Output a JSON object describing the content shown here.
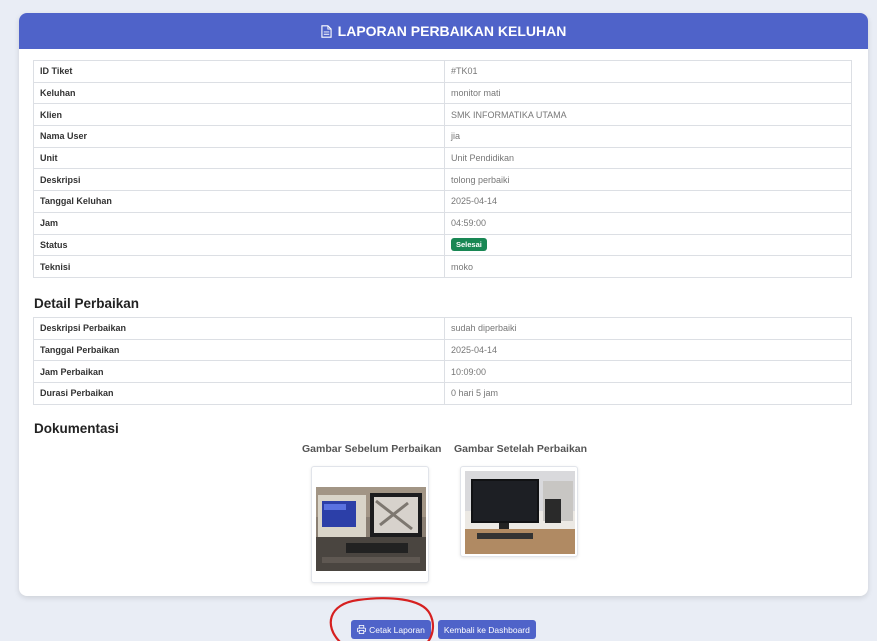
{
  "header": {
    "title": "LAPORAN PERBAIKAN KELUHAN",
    "icon": "document-icon"
  },
  "info_rows": [
    {
      "label": "ID Tiket",
      "value": "#TK01"
    },
    {
      "label": "Keluhan",
      "value": "monitor mati"
    },
    {
      "label": "Klien",
      "value": "SMK INFORMATIKA UTAMA"
    },
    {
      "label": "Nama User",
      "value": "jia"
    },
    {
      "label": "Unit",
      "value": "Unit Pendidikan"
    },
    {
      "label": "Deskripsi",
      "value": "tolong perbaiki"
    },
    {
      "label": "Tanggal Keluhan",
      "value": "2025-04-14"
    },
    {
      "label": "Jam",
      "value": "04:59:00"
    },
    {
      "label": "Status",
      "value": "Selesai"
    },
    {
      "label": "Teknisi",
      "value": "moko"
    }
  ],
  "detail": {
    "title": "Detail Perbaikan",
    "rows": [
      {
        "label": "Deskripsi Perbaikan",
        "value": "sudah diperbaiki"
      },
      {
        "label": "Tanggal Perbaikan",
        "value": "2025-04-14"
      },
      {
        "label": "Jam Perbaikan",
        "value": "10:09:00"
      },
      {
        "label": "Durasi Perbaikan",
        "value": "0 hari 5 jam"
      }
    ]
  },
  "documentation": {
    "title": "Dokumentasi",
    "before_caption": "Gambar Sebelum Perbaikan",
    "after_caption": "Gambar Setelah Perbaikan"
  },
  "buttons": {
    "print_label": "Cetak Laporan",
    "dashboard_label": "Kembali ke Dashboard"
  },
  "colors": {
    "primary": "#4f63c9",
    "success": "#198754",
    "annotation": "#d62020"
  }
}
